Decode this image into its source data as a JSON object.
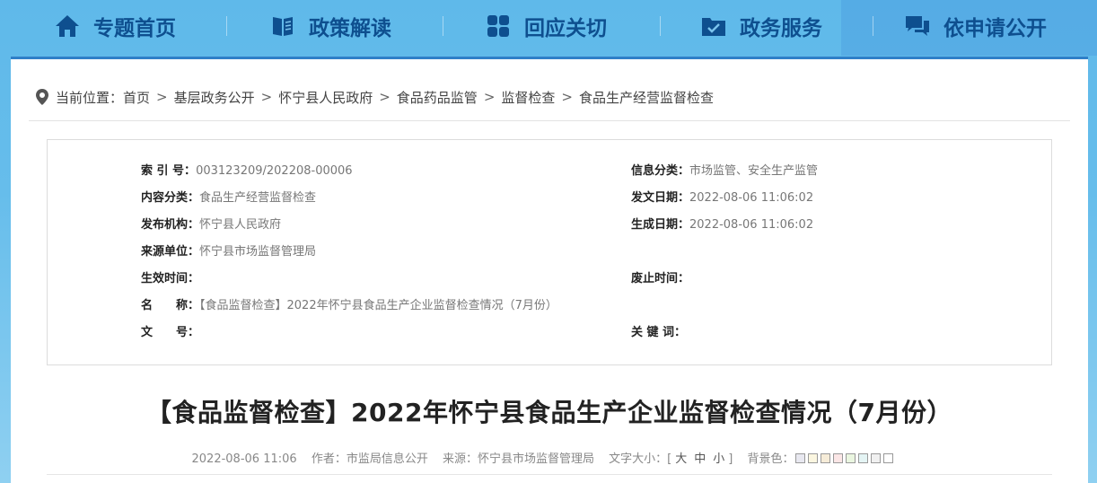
{
  "nav": [
    {
      "label": "专题首页",
      "icon": "home-icon"
    },
    {
      "label": "政策解读",
      "icon": "book-icon"
    },
    {
      "label": "回应关切",
      "icon": "grid-icon"
    },
    {
      "label": "政务服务",
      "icon": "folder-check-icon"
    },
    {
      "label": "依申请公开",
      "icon": "chat-icon"
    }
  ],
  "breadcrumb": {
    "prefix": "当前位置：",
    "items": [
      "首页",
      "基层政务公开",
      "怀宁县人民政府",
      "食品药品监管",
      "监督检查",
      "食品生产经营监督检查"
    ],
    "sep": ">"
  },
  "meta": {
    "index_k": "索 引 号：",
    "index_v": "003123209/202208-00006",
    "category_k": "信息分类：",
    "category_v": "市场监管、安全生产监管",
    "content_k": "内容分类：",
    "content_v": "食品生产经营监督检查",
    "issue_k": "发文日期：",
    "issue_v": "2022-08-06 11:06:02",
    "publisher_k": "发布机构：",
    "publisher_v": "怀宁县人民政府",
    "gen_k": "生成日期：",
    "gen_v": "2022-08-06 11:06:02",
    "source_k": "来源单位：",
    "source_v": "怀宁县市场监督管理局",
    "effective_k": "生效时间：",
    "effective_v": "",
    "abolish_k": "废止时间：",
    "abolish_v": "",
    "name_k": "名　　称：",
    "name_v": "【食品监督检查】2022年怀宁县食品生产企业监督检查情况（7月份）",
    "docno_k": "文　　号：",
    "docno_v": "",
    "keyword_k": "关 键 词：",
    "keyword_v": ""
  },
  "article": {
    "title": "【食品监督检查】2022年怀宁县食品生产企业监督检查情况（7月份）",
    "date": "2022-08-06 11:06",
    "author": "作者：市监局信息公开",
    "source": "来源：怀宁县市场监督管理局",
    "fontsize_label": "文字大小：[",
    "fs_large": "大",
    "fs_mid": "中",
    "fs_small": "小",
    "fontsize_end": "]",
    "bg_label": "背景色：",
    "bg_colors": [
      "#e8e8f0",
      "#fbf6e0",
      "#f6ecd8",
      "#fbe6e6",
      "#eaf6e0",
      "#e4f4f4",
      "#f0f0f0",
      "#ffffff"
    ]
  },
  "colors": {
    "accent": "#2f7fc8",
    "nav_text": "#0e4f8f"
  }
}
